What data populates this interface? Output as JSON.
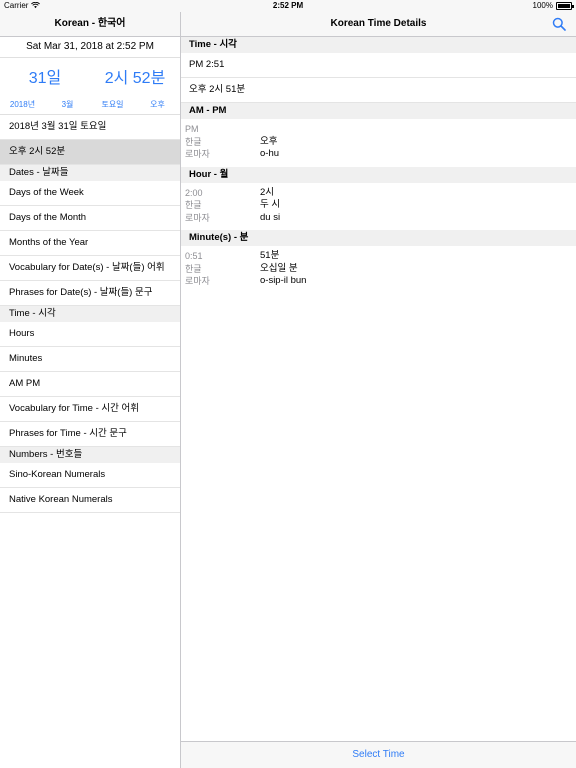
{
  "status": {
    "carrier": "Carrier",
    "time": "2:52 PM",
    "battery": "100%"
  },
  "left": {
    "title": "Korean - 한국어",
    "date_line": "Sat Mar 31, 2018 at 2:52 PM",
    "big": {
      "day": "31일",
      "time": "2시 52분"
    },
    "small": {
      "year": "2018년",
      "month": "3월",
      "weekday": "토요일",
      "ampm": "오후"
    },
    "rows": [
      {
        "label": "2018년 3월 31일 토요일"
      },
      {
        "label": "오후  2시 52분"
      }
    ],
    "sections": [
      {
        "header": "Dates - 날짜들",
        "items": [
          "Days of the Week",
          "Days of the Month",
          "Months of the Year",
          "Vocabulary for Date(s) - 날짜(들) 어휘",
          "Phrases for Date(s) - 날짜(들) 문구"
        ]
      },
      {
        "header": "Time - 시각",
        "items": [
          "Hours",
          "Minutes",
          "AM PM",
          "Vocabulary for Time - 시간 어휘",
          "Phrases for Time - 시간 문구"
        ]
      },
      {
        "header": "Numbers - 번호들",
        "items": [
          "Sino-Korean Numerals",
          "Native Korean Numerals"
        ]
      }
    ]
  },
  "right": {
    "title": "Korean Time Details",
    "time_section": {
      "header": "Time - 시각",
      "cells": [
        "PM 2:51",
        "오후  2시 51분"
      ]
    },
    "ampm": {
      "header": "AM - PM",
      "rows": [
        {
          "k": "PM",
          "v": ""
        },
        {
          "k": "한글",
          "v": "오후"
        },
        {
          "k": "로마자",
          "v": "o-hu"
        }
      ]
    },
    "hour": {
      "header": "Hour - 월",
      "rows": [
        {
          "k": "2:00",
          "v": "2시"
        },
        {
          "k": "한글",
          "v": "두 시"
        },
        {
          "k": "로마자",
          "v": "du si"
        }
      ]
    },
    "minute": {
      "header": "Minute(s) - 분",
      "rows": [
        {
          "k": "0:51",
          "v": "51분"
        },
        {
          "k": "한글",
          "v": "오십일 분"
        },
        {
          "k": "로마자",
          "v": "o-sip-il bun"
        }
      ]
    },
    "bottom_button": "Select Time"
  },
  "icons": {
    "search": "search-icon",
    "wifi": "wifi-icon",
    "battery": "battery-icon"
  },
  "colors": {
    "accent": "#2f7cf6",
    "selected_row": "#d9d9d9",
    "section_bg": "#f0f0f0"
  }
}
